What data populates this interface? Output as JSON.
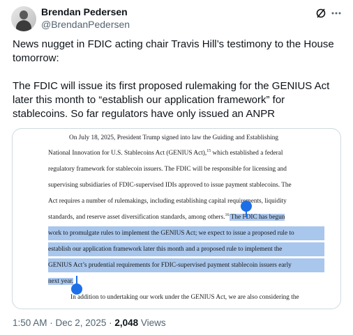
{
  "author": {
    "name": "Brendan Pedersen",
    "handle": "@BrendanPedersen"
  },
  "tweet": {
    "paragraph1": "News nugget in FDIC acting chair Travis Hill’s testimony to the House tomorrow:",
    "paragraph2": "The FDIC will issue its first proposed rulemaking for the GENIUS Act later this month to “establish our application framework” for stablecoins. So far regulators have only issued an ANPR"
  },
  "document": {
    "line1": "On July 18, 2025, President Trump signed into law the Guiding and Establishing",
    "line2": "National Innovation for U.S. Stablecoins Act (GENIUS Act),",
    "line2_sup": "15",
    "line2_end": " which established a federal",
    "line3": "regulatory framework for stablecoin issuers.  The FDIC will be responsible for licensing and",
    "line4": "supervising subsidiaries of FDIC-supervised IDIs approved to issue payment stablecoins.  The",
    "line5": "Act requires a number of rulemakings, including establishing capital requirements, liquidity",
    "line6_a": "standards, and reserve asset diversification standards, among others.",
    "line6_sup": "16",
    "line6_hl": "  The FDIC has begun",
    "line7": "work to promulgate rules to implement the GENIUS Act; we expect to issue a proposed rule to",
    "line8": "establish our application framework later this month and a proposed rule to implement the",
    "line9": "GENIUS Act’s prudential requirements for FDIC-supervised payment stablecoin issuers early",
    "line10": "next year.",
    "line11": "In addition to undertaking our work under the GENIUS Act, we are also considering the"
  },
  "meta": {
    "time": "1:50 AM",
    "separator": " · ",
    "date": "Dec 2, 2025",
    "separator2": " · ",
    "views_count": "2,048",
    "views_label": " Views"
  },
  "icons": {
    "grok": "grok-icon",
    "more": "more-icon"
  },
  "colors": {
    "highlight": "#a9c6ec",
    "selection_handle": "#1d6fe8",
    "secondary_text": "#536471"
  }
}
